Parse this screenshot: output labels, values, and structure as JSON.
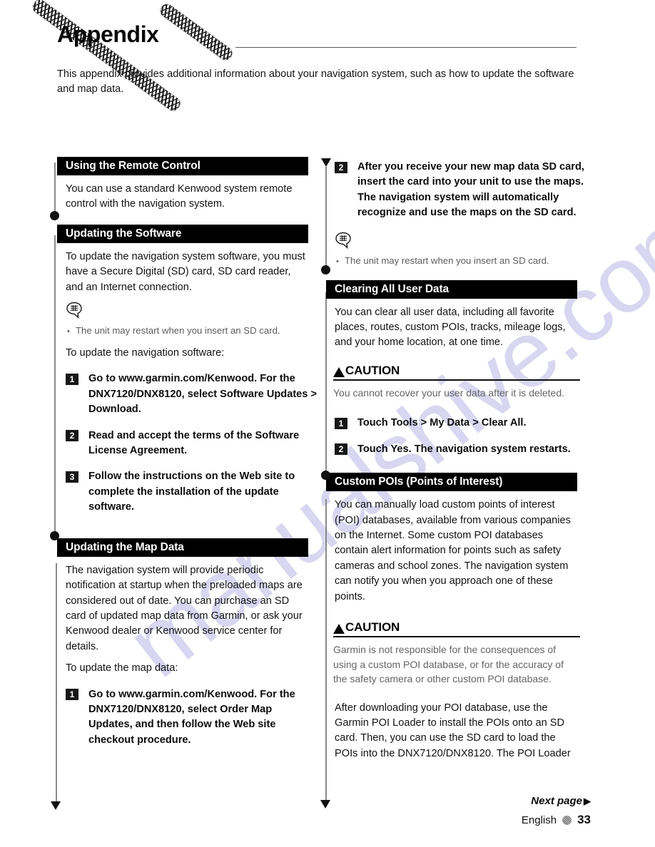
{
  "header": {
    "title": "Appendix",
    "intro": "This appendix provides additional information about your navigation system, such as how to update the software and map data."
  },
  "left_column": {
    "sections": [
      {
        "heading": "Using the Remote Control",
        "paragraphs": [
          "You can use a standard Kenwood system remote control with the navigation system."
        ]
      },
      {
        "heading": "Updating the Software",
        "paragraphs": [
          "To update the navigation system software, you must have a Secure Digital (SD) card, SD card reader, and an Internet connection."
        ],
        "note": {
          "icon": "note-bubble-icon",
          "lines": [
            "The unit may restart when you insert an SD card."
          ]
        },
        "lead_in": "To update the navigation software:",
        "steps": [
          {
            "num": "1",
            "text": "Go to www.garmin.com/Kenwood. For the DNX7120/DNX8120, select Software Updates > Download."
          },
          {
            "num": "2",
            "text": "Read and accept the terms of the Software License Agreement."
          },
          {
            "num": "3",
            "text": "Follow the instructions on the Web site to complete the installation of the update software."
          }
        ]
      },
      {
        "heading": "Updating the Map Data",
        "paragraphs": [
          "The navigation system will provide periodic notification at startup when the preloaded maps are considered out of date. You can purchase an SD card of updated map data from Garmin, or ask your Kenwood dealer or Kenwood service center for details."
        ],
        "lead_in": "To update the map data:",
        "steps": [
          {
            "num": "1",
            "text": "Go to www.garmin.com/Kenwood. For the DNX7120/DNX8120, select Order Map Updates, and then follow the Web site checkout procedure."
          }
        ]
      }
    ]
  },
  "right_column": {
    "continued_step": {
      "num": "2",
      "text": "After you receive your new map data SD card, insert the card into your unit to use the maps. The navigation system will automatically recognize and use the maps on the SD card."
    },
    "note": {
      "icon": "note-bubble-icon",
      "lines": [
        "The unit may restart when you insert an SD card."
      ]
    },
    "sections": [
      {
        "heading": "Clearing All User Data",
        "paragraphs": [
          "You can clear all user data, including all favorite places, routes, custom POIs, tracks, mileage logs, and your home location, at one time."
        ],
        "caution": {
          "label": "CAUTION",
          "icon": "warning-triangle-icon",
          "text": "You cannot recover your user data after it is deleted."
        },
        "steps": [
          {
            "num": "1",
            "text": "Touch Tools > My Data > Clear All."
          },
          {
            "num": "2",
            "text": "Touch Yes. The navigation system restarts."
          }
        ]
      },
      {
        "heading": "Custom POIs (Points of Interest)",
        "paragraphs": [
          "You can manually load custom points of interest (POI) databases, available from various companies on the Internet. Some custom POI databases contain alert information for points such as safety cameras and school zones. The navigation system can notify you when you approach one of these points."
        ],
        "caution": {
          "label": "CAUTION",
          "icon": "warning-triangle-icon",
          "text": "Garmin is not responsible for the consequences of using a custom POI database, or for the accuracy of the safety camera or other custom POI database."
        },
        "trailing_paragraph": "After downloading your POI database, use the Garmin POI Loader to install the POIs onto an SD card. Then, you can use the SD card to load the POIs into the DNX7120/DNX8120. The POI Loader"
      }
    ]
  },
  "footer": {
    "next_page": "Next page",
    "next_page_arrow": "▶",
    "language": "English",
    "page_number": "33"
  },
  "watermark": {
    "text": "manualshive.com"
  }
}
